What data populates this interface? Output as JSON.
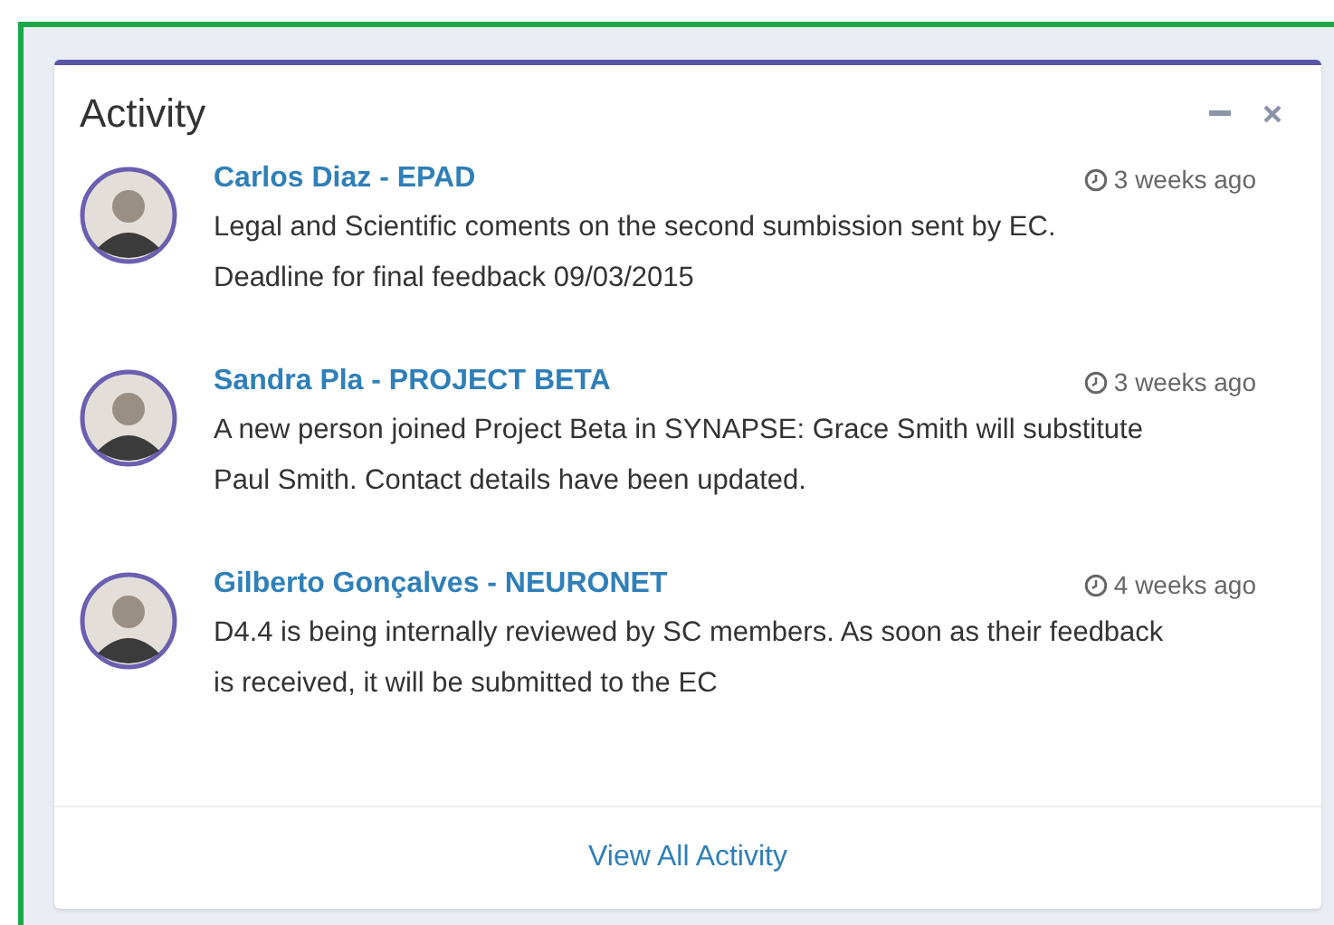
{
  "panel": {
    "title": "Activity",
    "footer_link": "View All Activity"
  },
  "activities": [
    {
      "author": "Carlos Diaz - EPAD",
      "time": "3 weeks ago",
      "message": "Legal and Scientific coments on the second sumbission sent by EC. Deadline for final feedback 09/03/2015"
    },
    {
      "author": "Sandra Pla - PROJECT BETA",
      "time": "3 weeks ago",
      "message": "A new person joined Project Beta in SYNAPSE: Grace Smith will substitute Paul Smith. Contact details have been updated."
    },
    {
      "author": "Gilberto Gonçalves - NEURONET",
      "time": "4 weeks ago",
      "message": "D4.4 is being internally reviewed by SC members. As soon as their feedback is received, it will be submitted to the EC"
    }
  ]
}
